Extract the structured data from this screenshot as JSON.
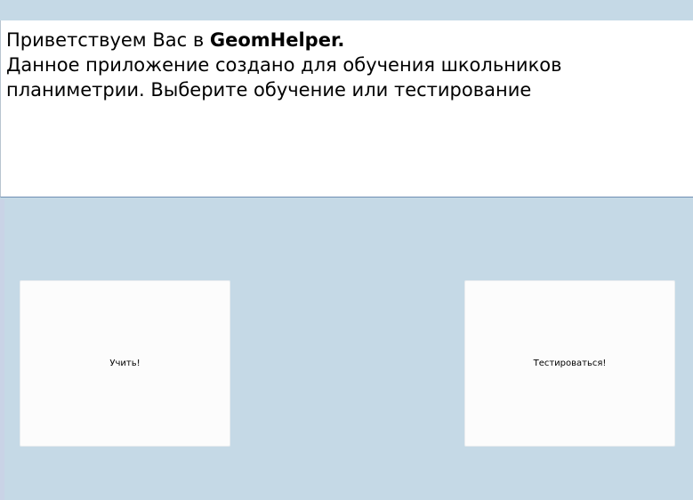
{
  "welcome": {
    "greeting_prefix": "Приветствуем Вас в ",
    "app_name": "GeomHelper.",
    "description": "Данное приложение создано для обучения школьников планиметрии. Выберите обучение или тестирование"
  },
  "buttons": {
    "learn_label": "Учить!",
    "test_label": "Тестироваться!"
  },
  "colors": {
    "background": "#c5d9e6",
    "panel": "#ffffff",
    "button": "#fcfcfc"
  }
}
